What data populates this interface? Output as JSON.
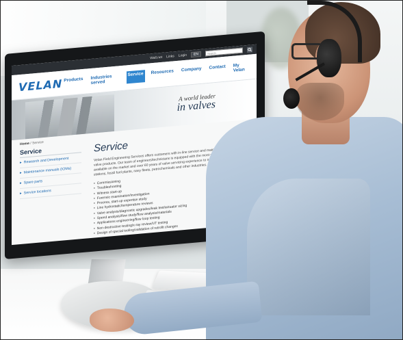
{
  "scene": {
    "description_colors": {
      "accent": "#1f6bb3",
      "nav_active_bg": "#2f86cf",
      "shirt": "#a7bdd4"
    }
  },
  "website": {
    "topbar": {
      "links": [
        "Wall.net",
        "Links",
        "Login"
      ],
      "language": "EN",
      "search_placeholder": "Search"
    },
    "logo": "VELAN",
    "nav": [
      {
        "label": "Products",
        "active": false
      },
      {
        "label": "Industries served",
        "active": false
      },
      {
        "label": "Service",
        "active": true
      },
      {
        "label": "Resources",
        "active": false
      },
      {
        "label": "Company",
        "active": false
      },
      {
        "label": "Contact",
        "active": false
      },
      {
        "label": "My Velan",
        "active": false
      }
    ],
    "banner": {
      "tagline_small": "A world leader",
      "tagline_large": "in valves"
    },
    "breadcrumb": {
      "home": "Home",
      "separator": "/",
      "current": "Service"
    },
    "sidebar": {
      "title": "Service",
      "items": [
        "Research and Development",
        "Maintenance manuals (IOMs)",
        "Spare parts",
        "Service locations"
      ]
    },
    "main": {
      "heading": "Service",
      "intro": "Velan Field Engineering Services offers customers with in-line service and maintenance on all our valve products. Our team of engineers/technicians is equipped with the most sophisticated tools available on the market and over 60 years of valve servicing experience to nuclear and thermal power stations, fossil fuel plants, navy fleets, petrochemicals and other industries. Our capabilities include:",
      "capabilities": [
        "Commissioning",
        "Troubleshooting",
        "Witness start-up",
        "Forensic examination/investigation",
        "Process, start-up expertise study",
        "Line hydrostatic/temperature reviews",
        "Valve analysis/diagnostic upgrades/leak test/actuator sizing",
        "Speed analysis/flow study/flow analysis/materials",
        "Applications engineering/flow loop testing",
        "Non-destructive testing/x-ray review/UT testing",
        "Design of special tooling/validation of retrofit changes"
      ]
    }
  }
}
